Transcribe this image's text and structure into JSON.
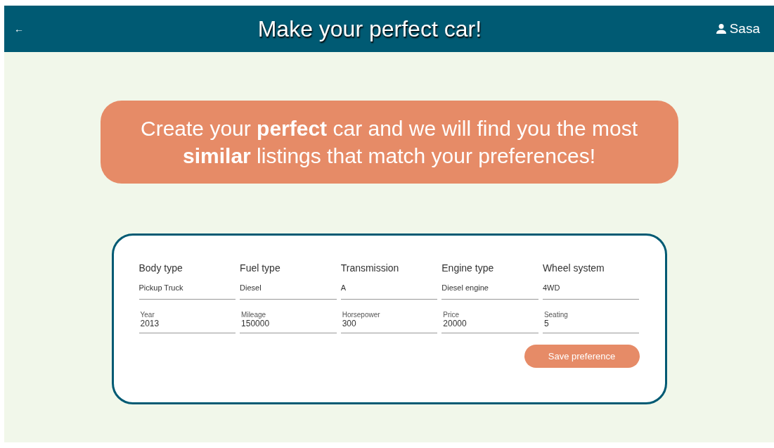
{
  "header": {
    "back": "←",
    "title": "Make your perfect car!",
    "user": "Sasa"
  },
  "banner": "Create your **perfect** car and we will find you the most **similar** listings that match your preferences!",
  "form": {
    "rows": [
      [
        {
          "kind": "select",
          "label": "Body type",
          "value": "Pickup Truck"
        },
        {
          "kind": "select",
          "label": "Fuel type",
          "value": "Diesel"
        },
        {
          "kind": "select",
          "label": "Transmission",
          "value": "A"
        },
        {
          "kind": "select",
          "label": "Engine type",
          "value": "Diesel engine"
        },
        {
          "kind": "select",
          "label": "Wheel system",
          "value": "4WD"
        }
      ],
      [
        {
          "kind": "input",
          "label": "Year",
          "value": "2013"
        },
        {
          "kind": "input",
          "label": "Mileage",
          "value": "150000"
        },
        {
          "kind": "input",
          "label": "Horsepower",
          "value": "300"
        },
        {
          "kind": "input",
          "label": "Price",
          "value": "20000"
        },
        {
          "kind": "input",
          "label": "Seating",
          "value": "5"
        }
      ]
    ],
    "button": "Save preference"
  }
}
